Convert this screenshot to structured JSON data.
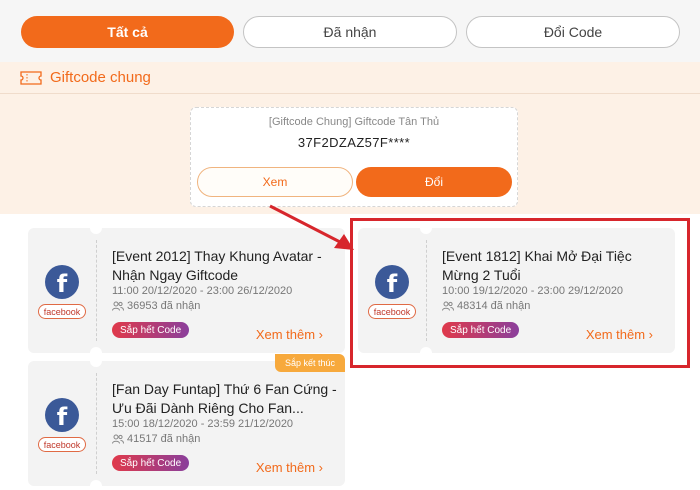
{
  "tabs": [
    {
      "label": "Tất cả",
      "active": true
    },
    {
      "label": "Đã nhận",
      "active": false
    },
    {
      "label": "Đổi Code",
      "active": false
    }
  ],
  "section": {
    "icon": "ticket-icon",
    "title": "Giftcode chung"
  },
  "giftcode": {
    "name": "[Giftcode Chung] Giftcode Tân Thủ",
    "code": "37F2DZAZ57F****",
    "view_label": "Xem",
    "redeem_label": "Đổi"
  },
  "events": [
    {
      "icon": "facebook-icon",
      "source_label": "facebook",
      "title": "[Event 2012] Thay Khung Avatar - Nhận Ngay Giftcode",
      "time": "11:00 20/12/2020 - 23:00 26/12/2020",
      "count": "36953 đã nhận",
      "badge": "Sắp hết Code",
      "more_label": "Xem thêm ›",
      "tag": ""
    },
    {
      "icon": "facebook-icon",
      "source_label": "facebook",
      "title": "[Event 1812] Khai Mở Đại Tiệc Mừng 2 Tuổi",
      "time": "10:00 19/12/2020 - 23:00 29/12/2020",
      "count": "48314 đã nhận",
      "badge": "Sắp hết Code",
      "more_label": "Xem thêm ›",
      "tag": ""
    },
    {
      "icon": "facebook-icon",
      "source_label": "facebook",
      "title": "[Fan Day Funtap] Thứ 6 Fan Cứng - Ưu Đãi Dành Riêng Cho Fan...",
      "time": "15:00 18/12/2020 - 23:59 21/12/2020",
      "count": "41517 đã nhận",
      "badge": "Sắp hết Code",
      "more_label": "Xem thêm ›",
      "tag": "Sắp kết thúc"
    }
  ],
  "colors": {
    "accent": "#f26a1b",
    "annotation": "#d7262c",
    "facebook": "#3b5998",
    "tag": "#f7a93c"
  }
}
